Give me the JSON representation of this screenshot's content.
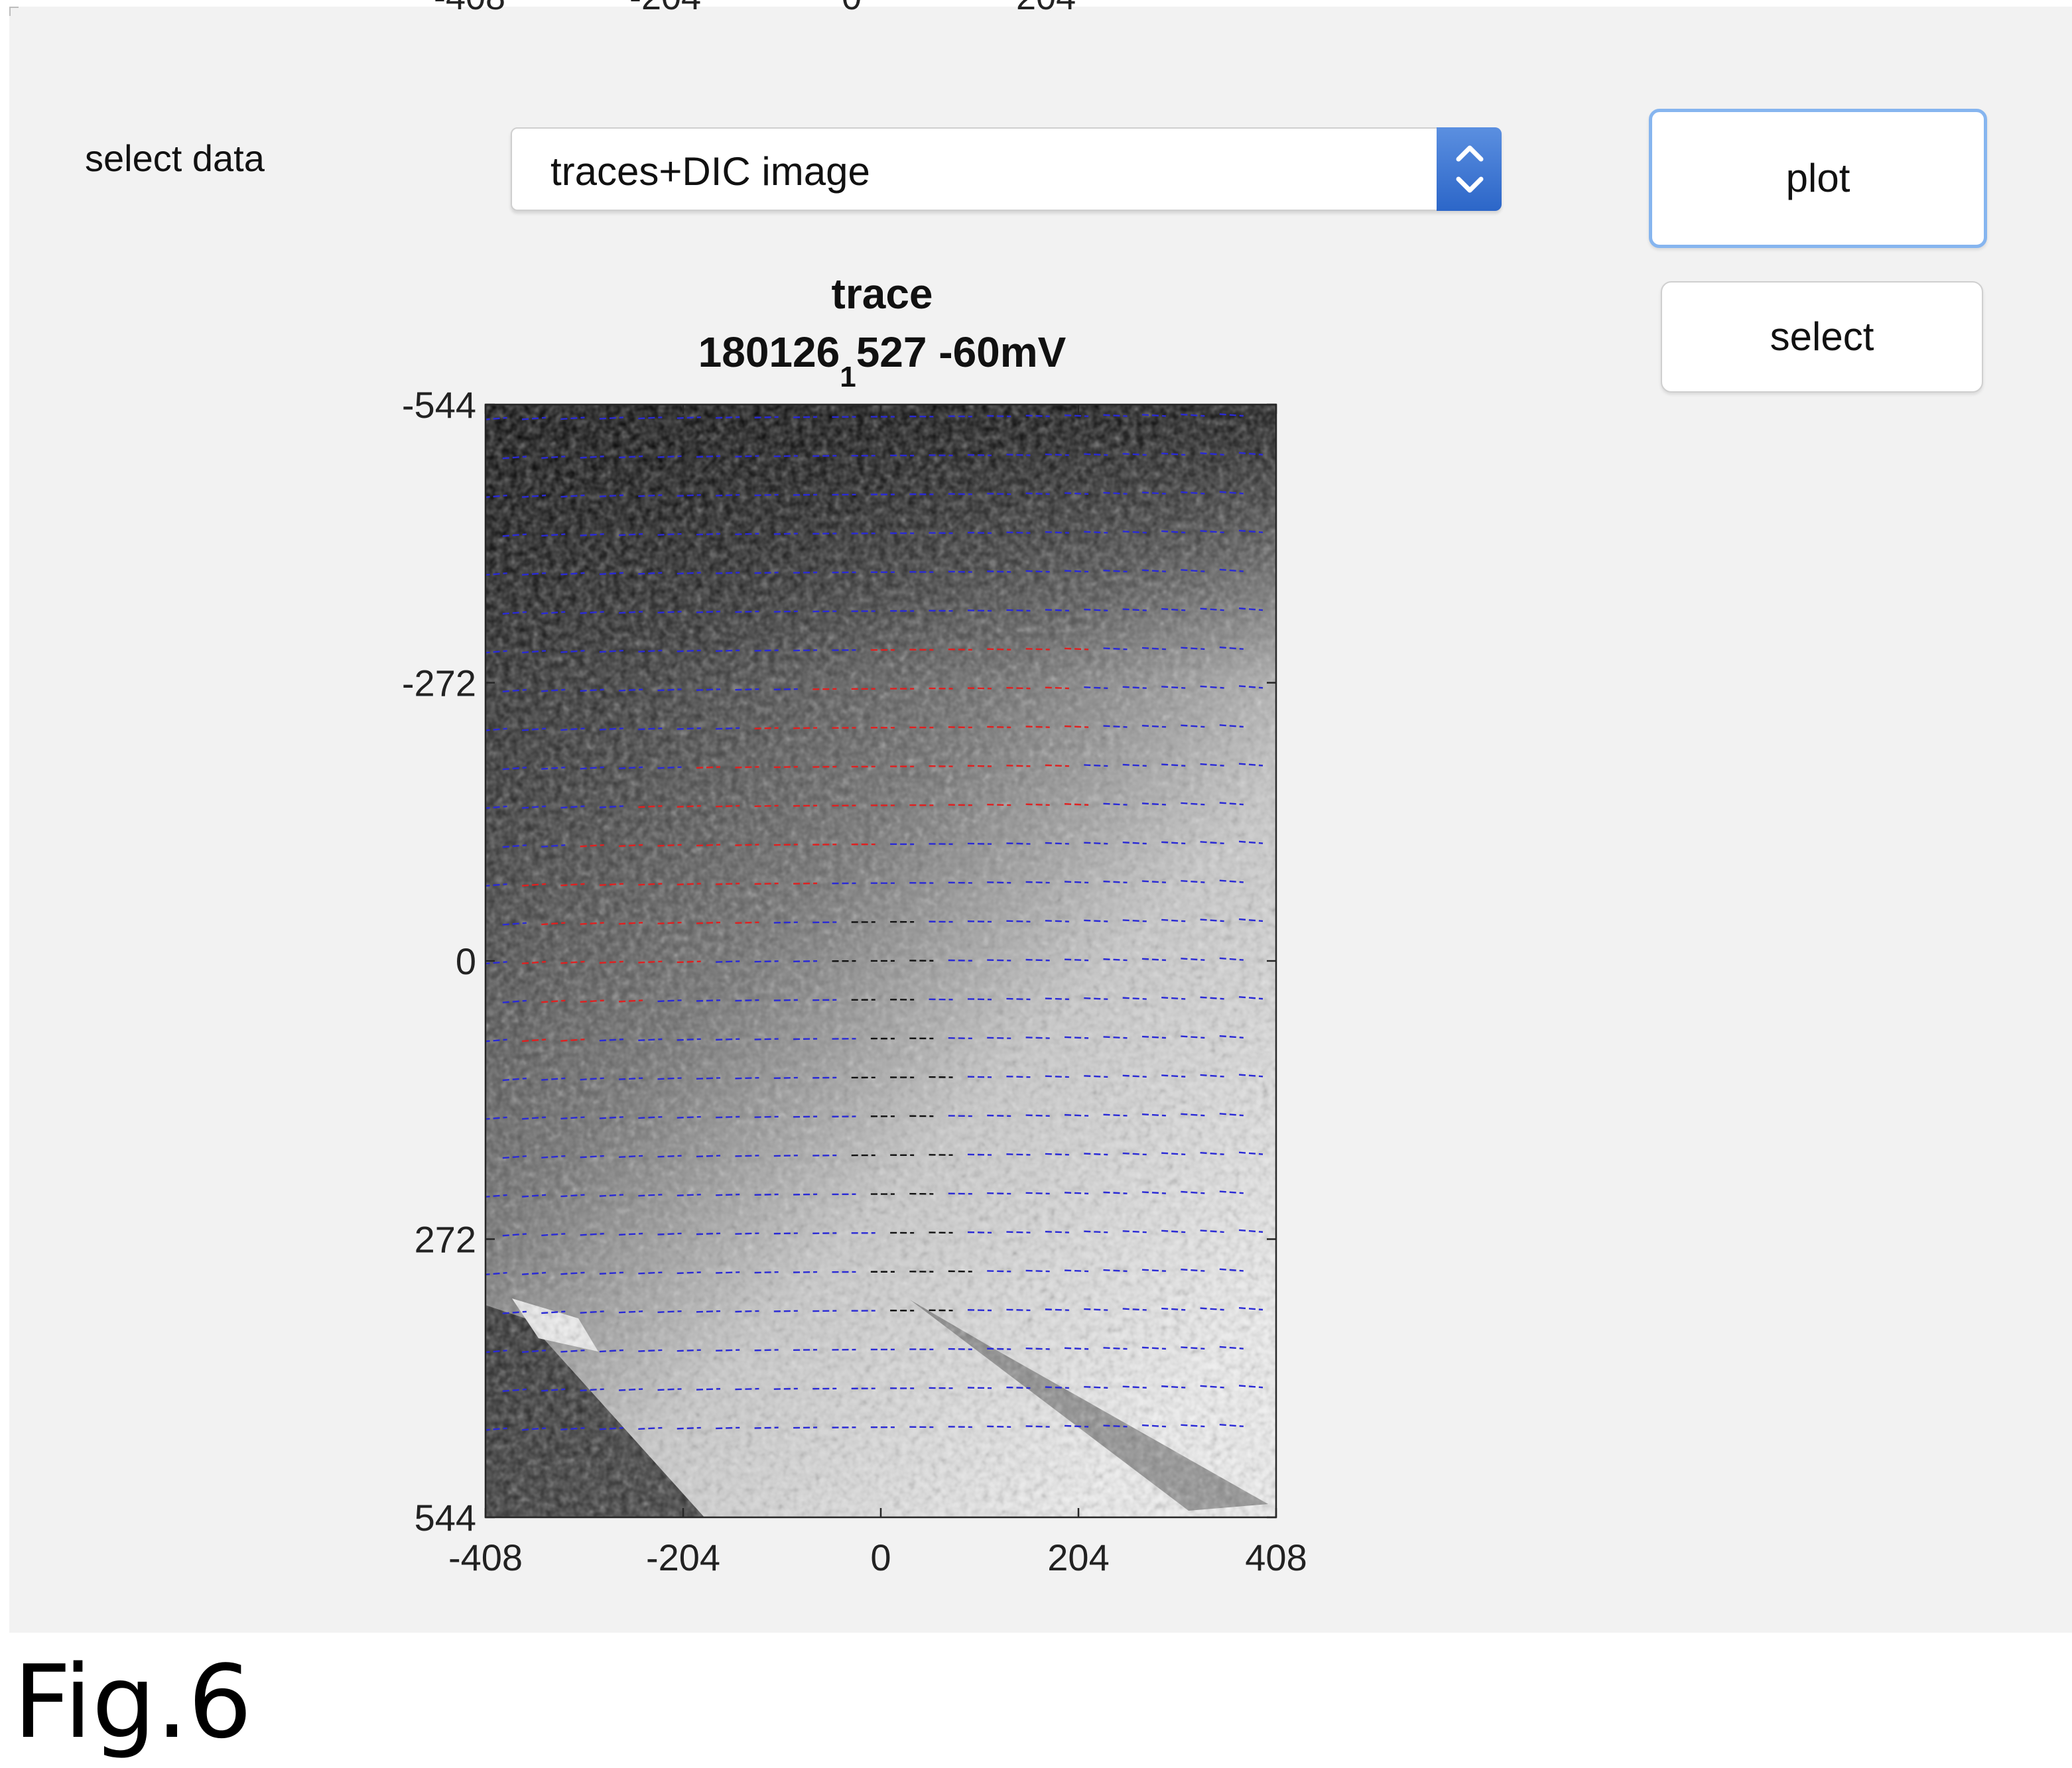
{
  "top_partial_ticks": [
    "-408",
    "-204",
    "0",
    "204"
  ],
  "controls": {
    "select_label": "select data",
    "dropdown_value": "traces+DIC image",
    "plot_button": "plot",
    "select_button": "select"
  },
  "chart_data": {
    "type": "scatter",
    "title": "trace",
    "subtitle_prefix": "180126",
    "subtitle_subscript": "1",
    "subtitle_suffix": "527 -60mV",
    "xlim": [
      -408,
      408
    ],
    "ylim": [
      -544,
      544
    ],
    "x_ticks": [
      "-408",
      "-204",
      "0",
      "204",
      "408"
    ],
    "y_ticks": [
      "-544",
      "-272",
      "0",
      "272",
      "544"
    ],
    "y_reversed": true,
    "background": "grayscale DIC image",
    "series": [
      {
        "color": "#2a2ad6",
        "marker": "short horizontal dash"
      },
      {
        "color": "#e02020",
        "marker": "short horizontal dash"
      },
      {
        "color": "#111111",
        "marker": "short dark dash"
      }
    ],
    "grid_spacing": {
      "dx": 40,
      "dy": 38
    }
  },
  "caption": "Fig.6"
}
